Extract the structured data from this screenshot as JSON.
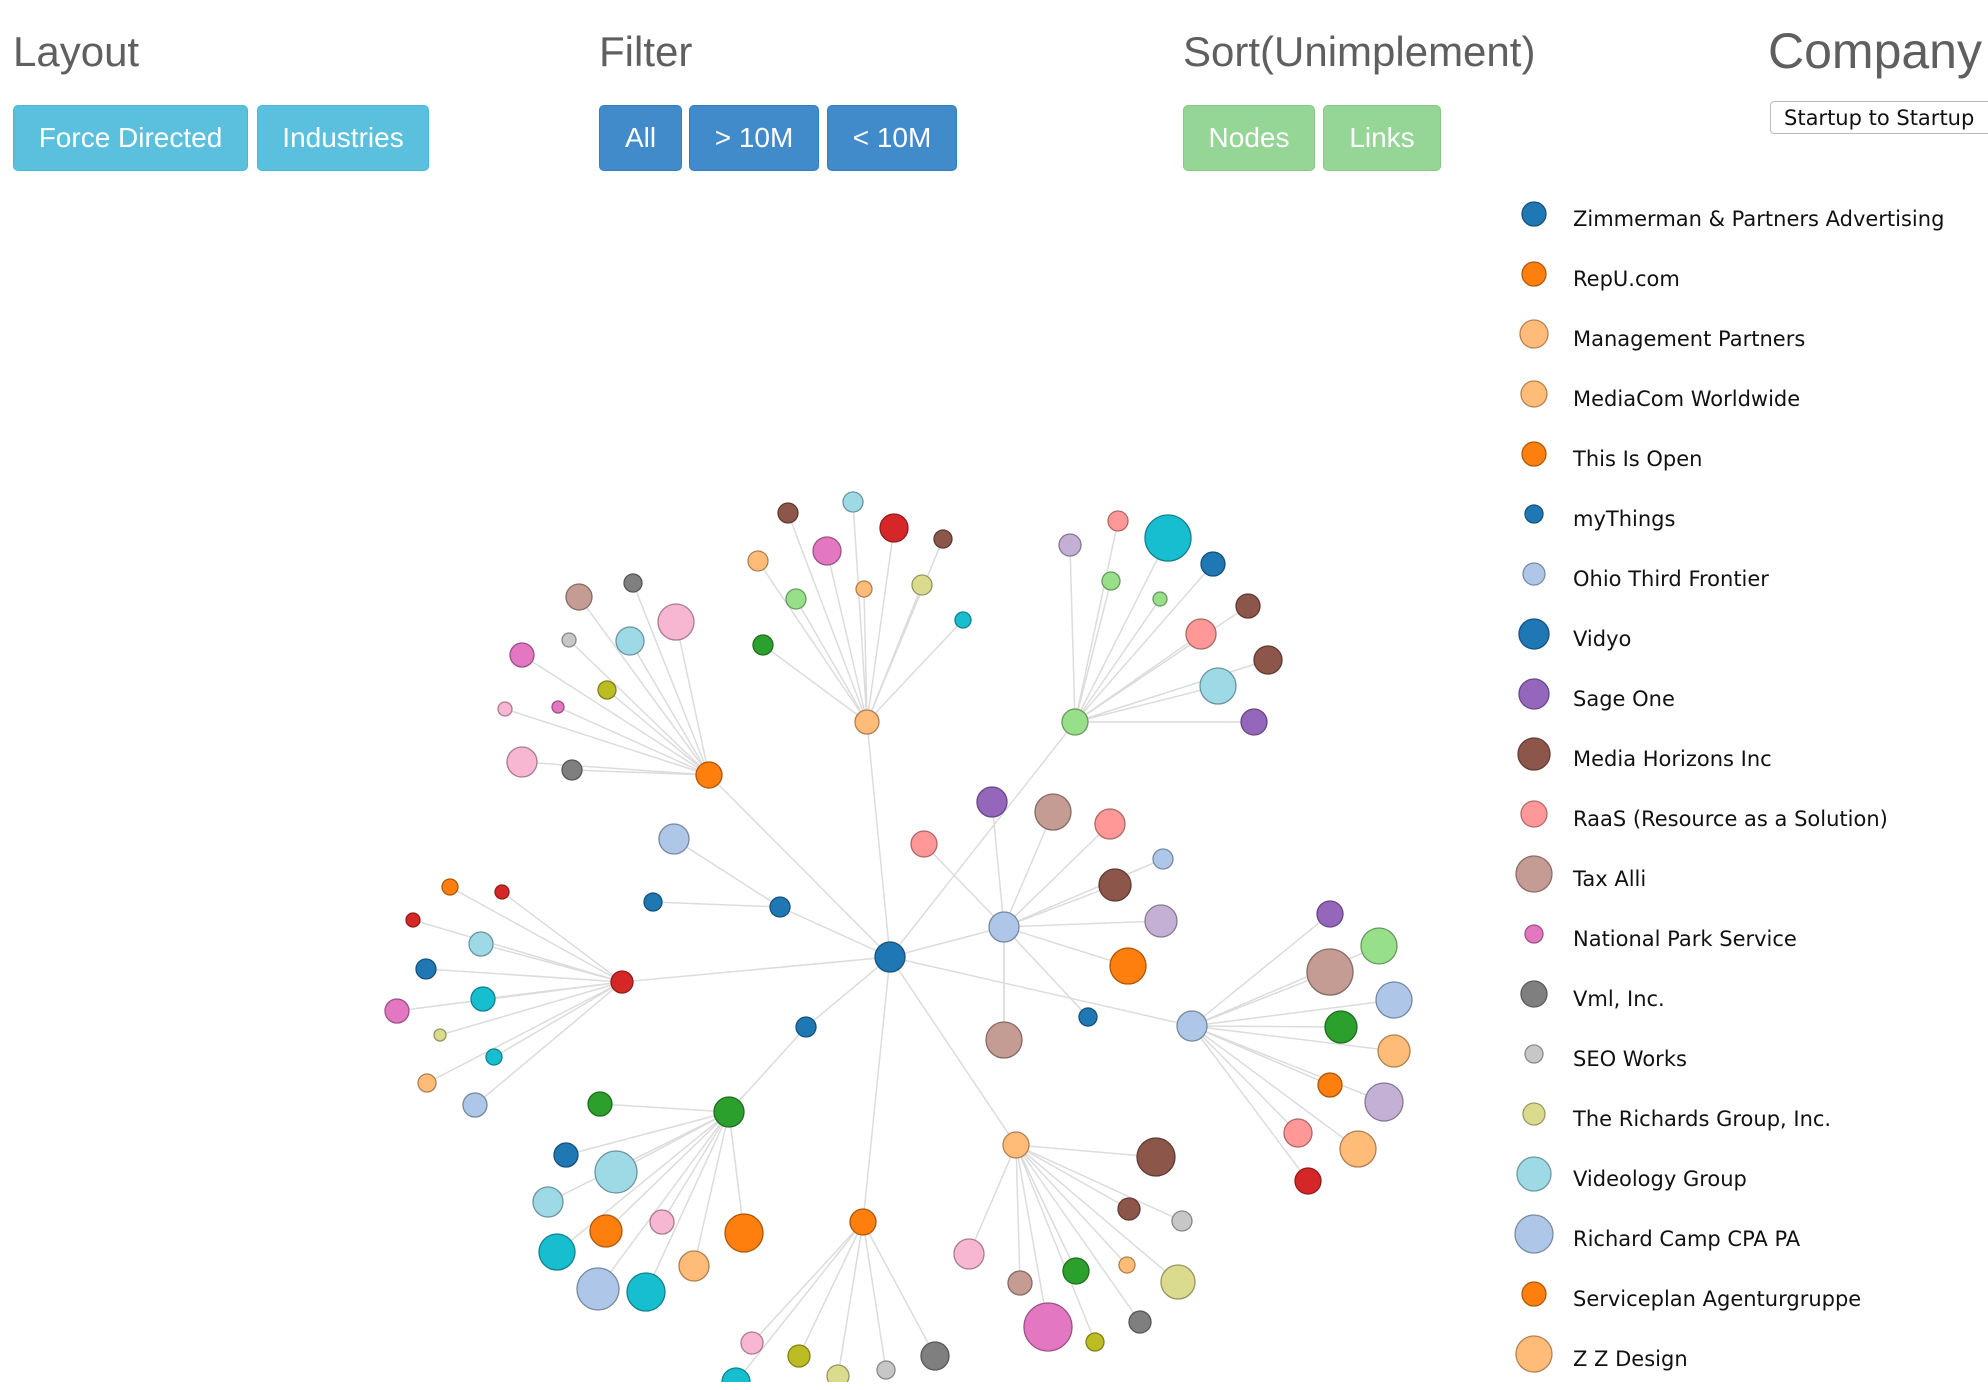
{
  "controls": {
    "layout": {
      "title": "Layout",
      "buttons": [
        "Force Directed",
        "Industries"
      ]
    },
    "filter": {
      "title": "Filter",
      "buttons": [
        "All",
        "> 10M",
        "< 10M"
      ]
    },
    "sort": {
      "title": "Sort(Unimplement)",
      "buttons": [
        "Nodes",
        "Links"
      ]
    },
    "company": {
      "title": "Company",
      "selected": "Startup to Startup"
    }
  },
  "colors": {
    "info": "#5bc0de",
    "primary": "#428bca",
    "success": "#95d595",
    "link": "#dcdcdc"
  },
  "legend": [
    {
      "label": "Zimmerman & Partners Advertising",
      "color": "#1f77b4"
    },
    {
      "label": "RepU.com",
      "color": "#ff7f0e"
    },
    {
      "label": "Management Partners",
      "color": "#ffbb78"
    },
    {
      "label": "MediaCom Worldwide",
      "color": "#ffbb78"
    },
    {
      "label": "This Is Open",
      "color": "#ff7f0e"
    },
    {
      "label": "myThings",
      "color": "#1f77b4"
    },
    {
      "label": "Ohio Third Frontier",
      "color": "#aec7e8"
    },
    {
      "label": "Vidyo",
      "color": "#1f77b4"
    },
    {
      "label": "Sage One",
      "color": "#9467bd"
    },
    {
      "label": "Media Horizons Inc",
      "color": "#8c564b"
    },
    {
      "label": "RaaS (Resource as a Solution)",
      "color": "#ff9896"
    },
    {
      "label": "Tax Alli",
      "color": "#c49c94"
    },
    {
      "label": "National Park Service",
      "color": "#e377c2"
    },
    {
      "label": "Vml, Inc.",
      "color": "#7f7f7f"
    },
    {
      "label": "SEO Works",
      "color": "#c7c7c7"
    },
    {
      "label": "The Richards Group, Inc.",
      "color": "#dbdb8d"
    },
    {
      "label": "Videology Group",
      "color": "#9edae5"
    },
    {
      "label": "Richard Camp CPA PA",
      "color": "#aec7e8"
    },
    {
      "label": "Serviceplan Agenturgruppe",
      "color": "#ff7f0e"
    },
    {
      "label": "Z Z Design",
      "color": "#ffbb78"
    }
  ]
}
